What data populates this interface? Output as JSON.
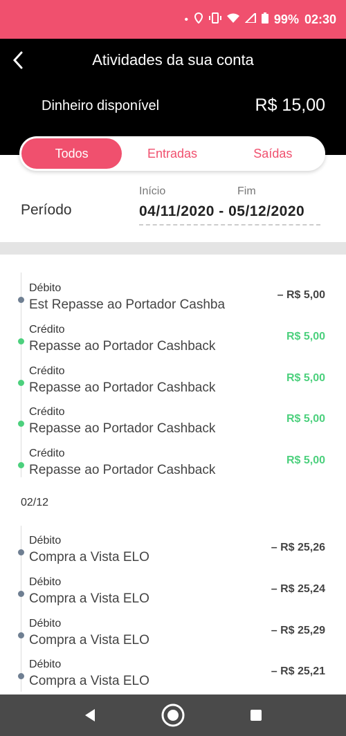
{
  "status_bar": {
    "icons": [
      "dot",
      "location-icon",
      "vibrate-icon",
      "wifi-icon",
      "signal-icon",
      "battery-icon"
    ],
    "battery": "99%",
    "time": "02:30",
    "color": "#f0506e"
  },
  "header": {
    "back_icon": "‹",
    "title": "Atividades da sua conta",
    "balance_label": "Dinheiro disponível",
    "balance_value": "R$ 15,00"
  },
  "tabs": [
    {
      "label": "Todos",
      "active": true
    },
    {
      "label": "Entradas",
      "active": false
    },
    {
      "label": "Saídas",
      "active": false
    }
  ],
  "period": {
    "label": "Período",
    "start_label": "Início",
    "end_label": "Fim",
    "range": "04/11/2020 - 05/12/2020"
  },
  "groups": [
    {
      "date": "",
      "transactions": [
        {
          "type": "Débito",
          "description": "Est Repasse ao Portador Cashba",
          "amount": "– R$ 5,00",
          "kind": "debit"
        },
        {
          "type": "Crédito",
          "description": "Repasse ao Portador Cashback",
          "amount": "R$ 5,00",
          "kind": "credit"
        },
        {
          "type": "Crédito",
          "description": "Repasse ao Portador Cashback",
          "amount": "R$ 5,00",
          "kind": "credit"
        },
        {
          "type": "Crédito",
          "description": "Repasse ao Portador Cashback",
          "amount": "R$ 5,00",
          "kind": "credit"
        },
        {
          "type": "Crédito",
          "description": "Repasse ao Portador Cashback",
          "amount": "R$ 5,00",
          "kind": "credit"
        }
      ]
    },
    {
      "date": "02/12",
      "transactions": [
        {
          "type": "Débito",
          "description": "Compra a Vista ELO",
          "amount": "– R$ 25,26",
          "kind": "debit"
        },
        {
          "type": "Débito",
          "description": "Compra a Vista ELO",
          "amount": "– R$ 25,24",
          "kind": "debit"
        },
        {
          "type": "Débito",
          "description": "Compra a Vista ELO",
          "amount": "– R$ 25,29",
          "kind": "debit"
        },
        {
          "type": "Débito",
          "description": "Compra a Vista ELO",
          "amount": "– R$ 25,21",
          "kind": "debit"
        }
      ]
    }
  ],
  "nav_bar": {
    "buttons": [
      "back-triangle-icon",
      "home-circle-icon",
      "recents-square-icon"
    ]
  },
  "colors": {
    "accent": "#f0506e",
    "credit": "#4cd07d",
    "debit_dot": "#6f7f92",
    "header_bg": "#000000"
  }
}
